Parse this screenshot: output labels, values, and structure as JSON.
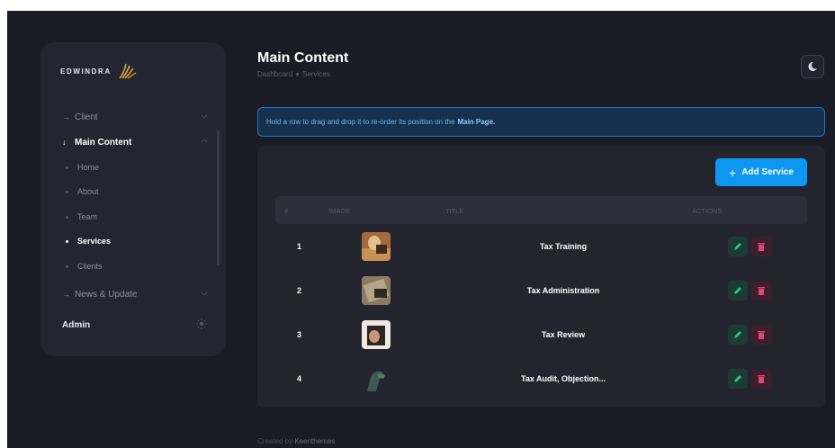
{
  "sidebar": {
    "logo_text": "EDWINDRA",
    "items": [
      {
        "label": "Client",
        "arrow": "→"
      },
      {
        "label": "Main Content",
        "arrow": "↓"
      },
      {
        "label": "News & Update",
        "arrow": "→"
      }
    ],
    "sub_items": [
      "Home",
      "About",
      "Team",
      "Services",
      "Clients"
    ],
    "admin_label": "Admin"
  },
  "header": {
    "title": "Main Content",
    "breadcrumb": [
      "Dashboard",
      "Services"
    ]
  },
  "alert": {
    "text": "Hold a row to drag and drop it to re-order its position on the",
    "emphasis": "Main Page."
  },
  "toolbar": {
    "add_label": "Add Service"
  },
  "table": {
    "columns": [
      "#",
      "IMAGE",
      "TITLE",
      "ACTIONS"
    ],
    "rows": [
      {
        "num": "1",
        "title": "Tax Training",
        "image": "tax-training-thumbnail"
      },
      {
        "num": "2",
        "title": "Tax Administration",
        "image": "tax-administration-thumbnail"
      },
      {
        "num": "3",
        "title": "Tax Review",
        "image": "tax-review-thumbnail"
      },
      {
        "num": "4",
        "title": "Tax Audit, Objection...",
        "image": "tax-audit-thumbnail"
      }
    ]
  },
  "footer": {
    "prefix": "Created by",
    "author": "Keenthemes"
  },
  "colors": {
    "accent": "#0d97f2",
    "background": "#1b1b26",
    "panel": "#24242f",
    "edit": "#2fc48d",
    "delete": "#e5446d",
    "alert_border": "#1d74c4"
  },
  "icons": {
    "theme_toggle": "moon-icon",
    "edit": "pencil-icon",
    "delete": "trash-icon",
    "admin": "sun-icon"
  }
}
